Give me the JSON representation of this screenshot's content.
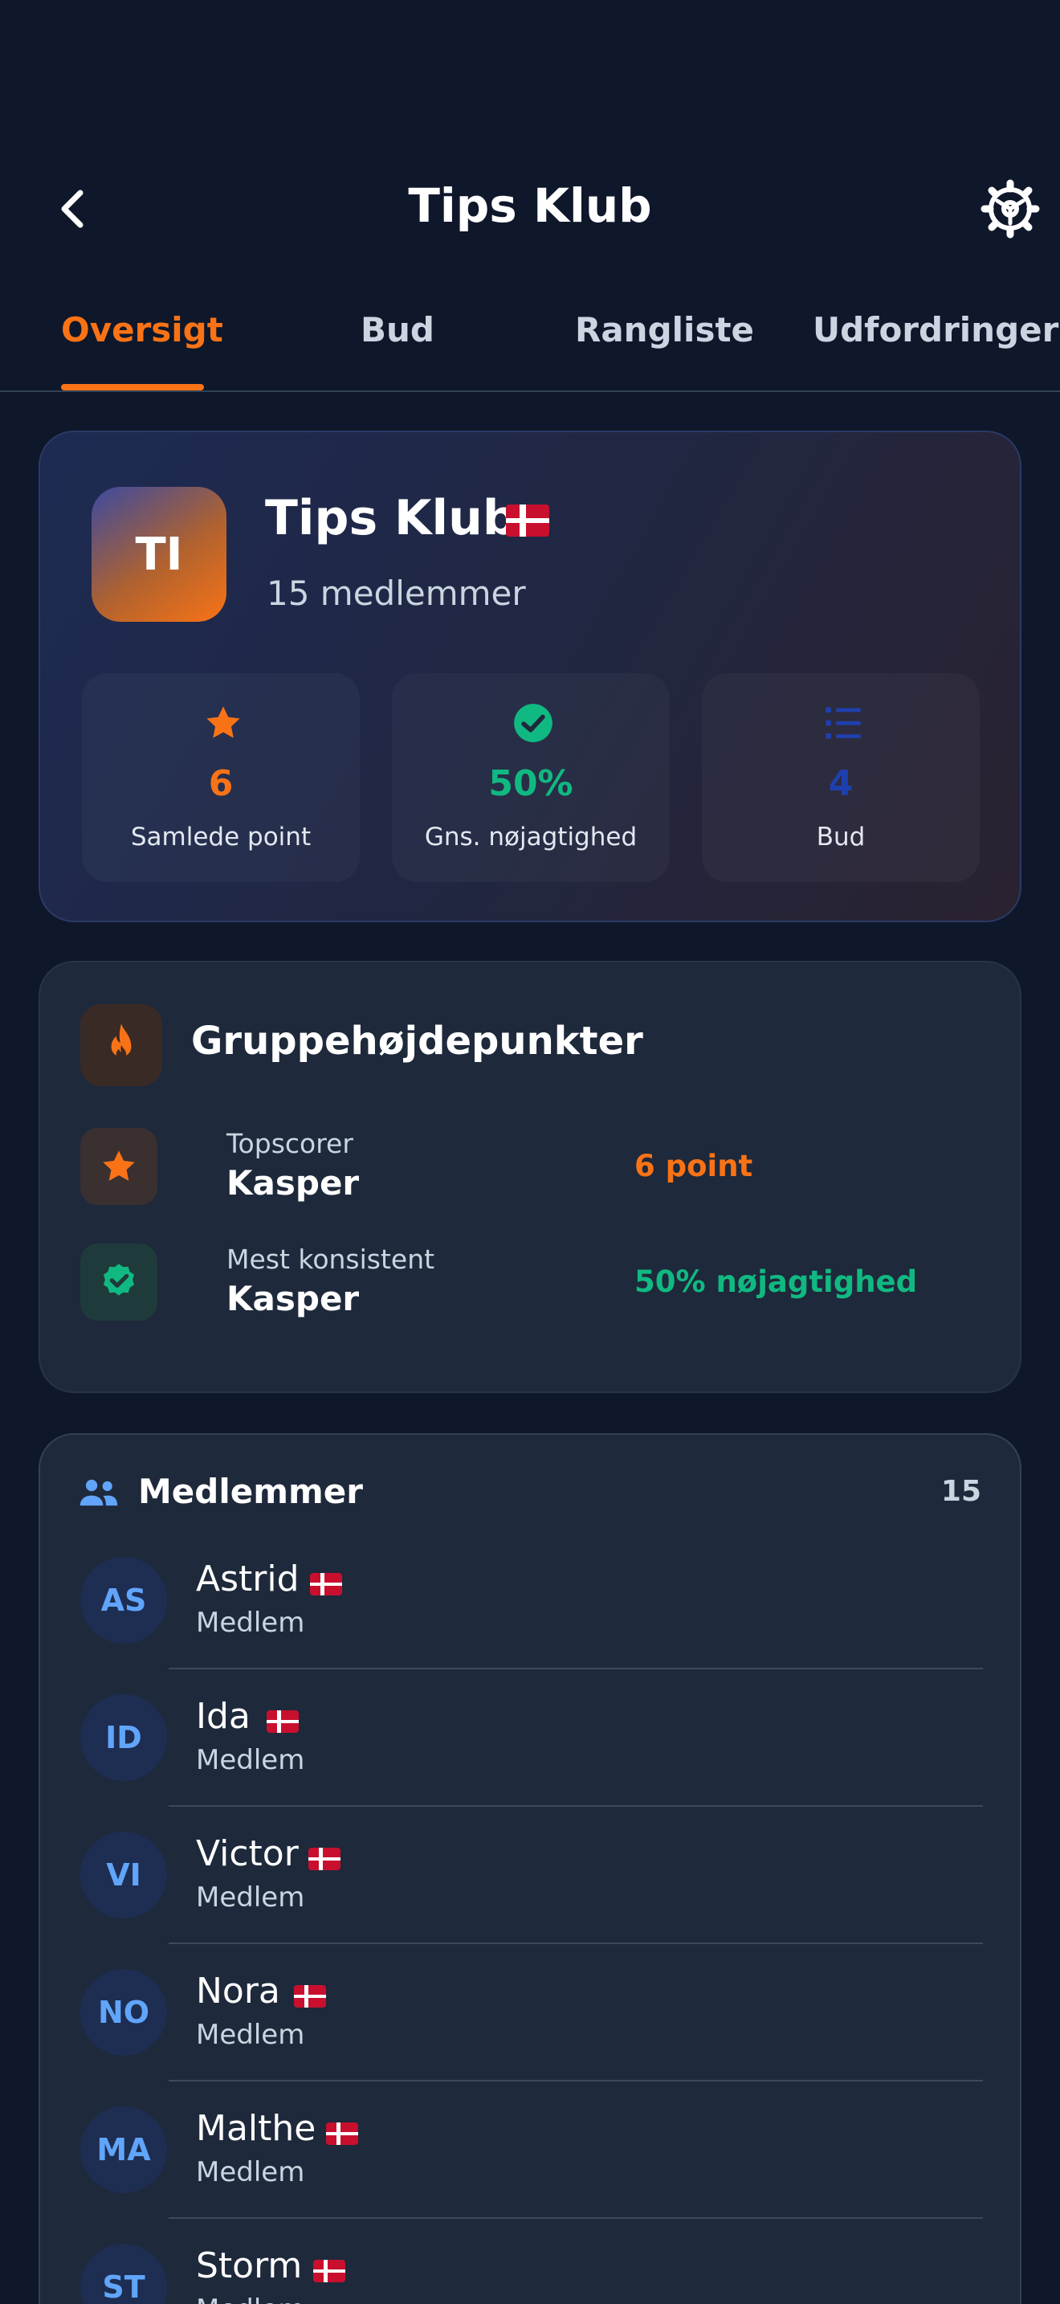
{
  "header": {
    "title": "Tips Klub"
  },
  "tabs": [
    {
      "label": "Oversigt",
      "active": true
    },
    {
      "label": "Bud",
      "active": false
    },
    {
      "label": "Rangliste",
      "active": false
    },
    {
      "label": "Udfordringer",
      "active": false
    }
  ],
  "club": {
    "initials": "TI",
    "name": "Tips Klub",
    "members_text": "15 medlemmer",
    "stats": [
      {
        "icon": "star-icon",
        "value": "6",
        "label": "Samlede point",
        "color": "#f97316"
      },
      {
        "icon": "check-circle-icon",
        "value": "50%",
        "label": "Gns. nøjagtighed",
        "color": "#10b981"
      },
      {
        "icon": "list-icon",
        "value": "4",
        "label": "Bud",
        "color": "#1e40af"
      }
    ]
  },
  "highlights": {
    "title": "Gruppehøjdepunkter",
    "icon": "flame-icon",
    "items": [
      {
        "icon": "star-icon",
        "label": "Topscorer",
        "name": "Kasper",
        "value": "6 point",
        "color": "#f97316"
      },
      {
        "icon": "verified-badge-icon",
        "label": "Mest konsistent",
        "name": "Kasper",
        "value": "50% nøjagtighed",
        "color": "#10b981"
      }
    ]
  },
  "members": {
    "title": "Medlemmer",
    "count": "15",
    "list": [
      {
        "initials": "AS",
        "name": "Astrid",
        "role": "Medlem"
      },
      {
        "initials": "ID",
        "name": "Ida",
        "role": "Medlem"
      },
      {
        "initials": "VI",
        "name": "Victor",
        "role": "Medlem"
      },
      {
        "initials": "NO",
        "name": "Nora",
        "role": "Medlem"
      },
      {
        "initials": "MA",
        "name": "Malthe",
        "role": "Medlem"
      },
      {
        "initials": "ST",
        "name": "Storm",
        "role": "Medlem"
      }
    ]
  },
  "colors": {
    "background": "#0f172a",
    "card": "#1e293b",
    "accent": "#f97316",
    "success": "#10b981",
    "info": "#60a5fa"
  }
}
